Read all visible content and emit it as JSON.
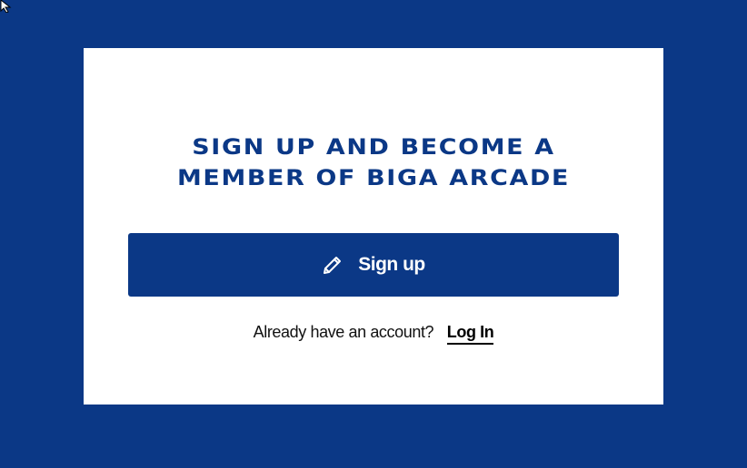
{
  "colors": {
    "background": "#0b3886",
    "card": "#ffffff",
    "accent": "#0b3886",
    "text": "#111111"
  },
  "headline": {
    "line1": "SIGN UP AND BECOME A",
    "line2": "MEMBER OF BIGA ARCADE"
  },
  "signup_button": {
    "icon": "pencil-icon",
    "label": "Sign up"
  },
  "login": {
    "prompt": "Already have an account?",
    "link_label": "Log In"
  },
  "cursor": {
    "icon": "mouse-pointer-icon"
  }
}
